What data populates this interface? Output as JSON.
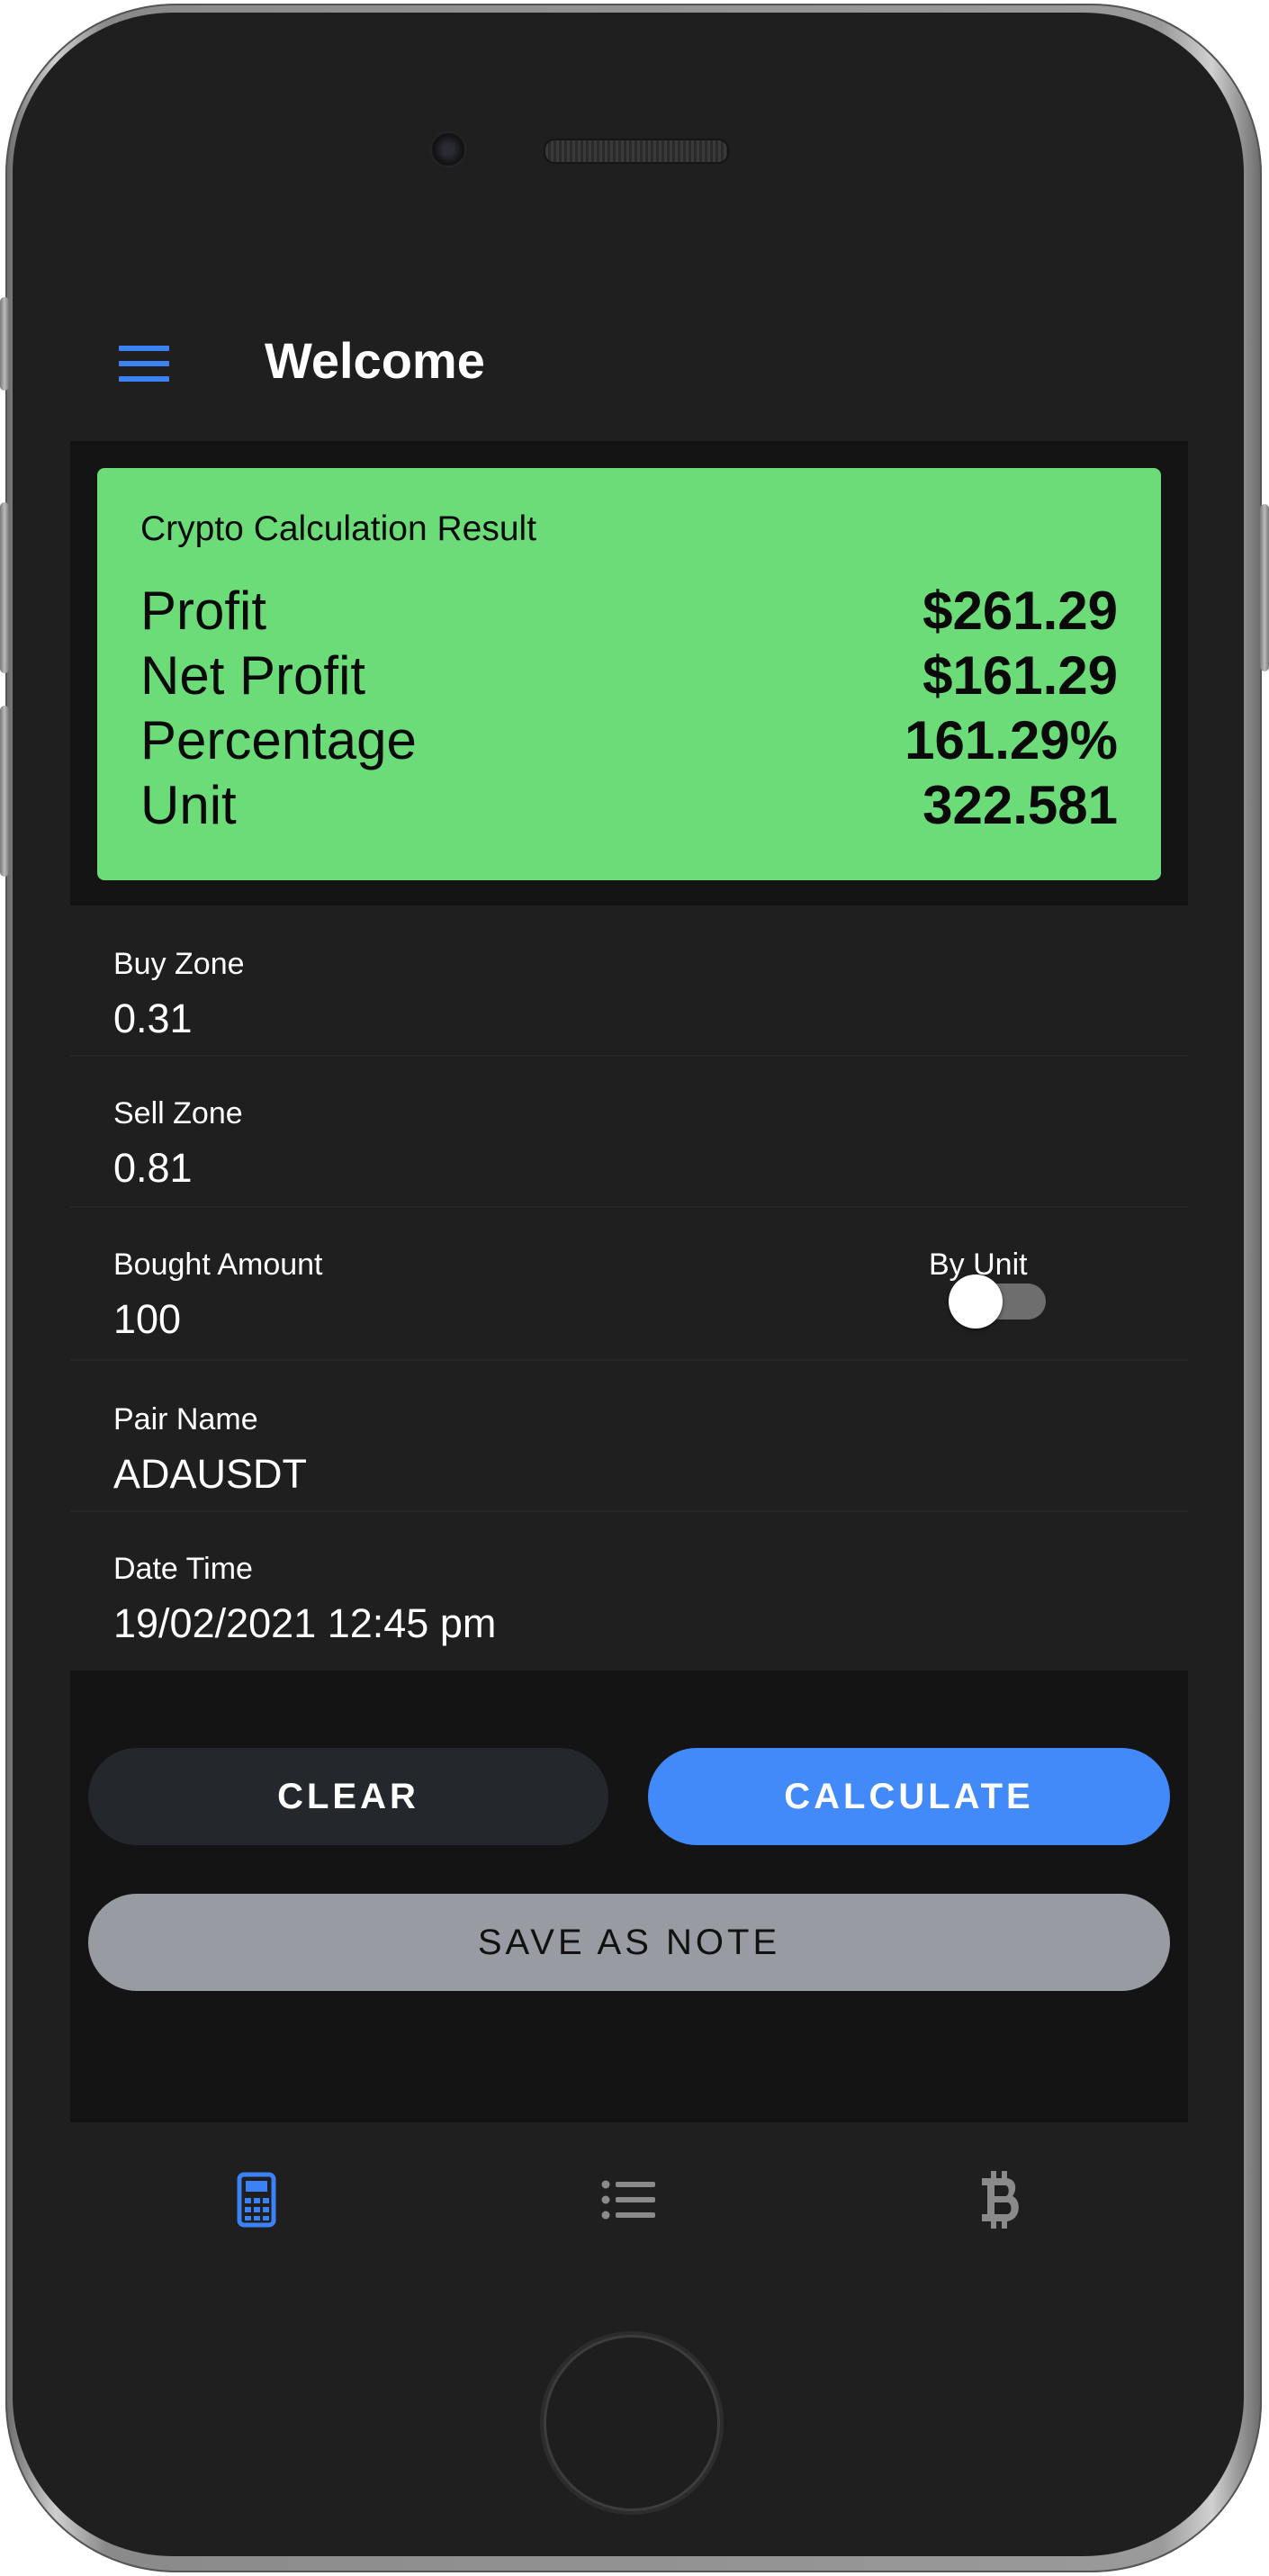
{
  "app": {
    "title": "Welcome"
  },
  "result": {
    "title": "Crypto Calculation Result",
    "rows": [
      {
        "label": "Profit",
        "value": "$261.29"
      },
      {
        "label": "Net Profit",
        "value": "$161.29"
      },
      {
        "label": "Percentage",
        "value": "161.29%"
      },
      {
        "label": "Unit",
        "value": "322.581"
      }
    ],
    "color": "#6bdc78"
  },
  "form": {
    "buy_zone": {
      "label": "Buy Zone",
      "value": "0.31"
    },
    "sell_zone": {
      "label": "Sell Zone",
      "value": "0.81"
    },
    "bought_amount": {
      "label": "Bought Amount",
      "value": "100"
    },
    "by_unit": {
      "label": "By Unit",
      "on": false
    },
    "pair_name": {
      "label": "Pair Name",
      "value": "ADAUSDT"
    },
    "date_time": {
      "label": "Date Time",
      "value": "19/02/2021 12:45 pm"
    }
  },
  "buttons": {
    "clear": "CLEAR",
    "calculate": "CALCULATE",
    "save_note": "SAVE AS NOTE"
  },
  "bottom_nav": {
    "items": [
      {
        "icon": "calculator-icon",
        "active": true
      },
      {
        "icon": "list-icon",
        "active": false
      },
      {
        "icon": "bitcoin-icon",
        "active": false
      }
    ]
  },
  "colors": {
    "accent": "#4289fa",
    "background": "#141414",
    "surface": "#1f1f1f"
  }
}
